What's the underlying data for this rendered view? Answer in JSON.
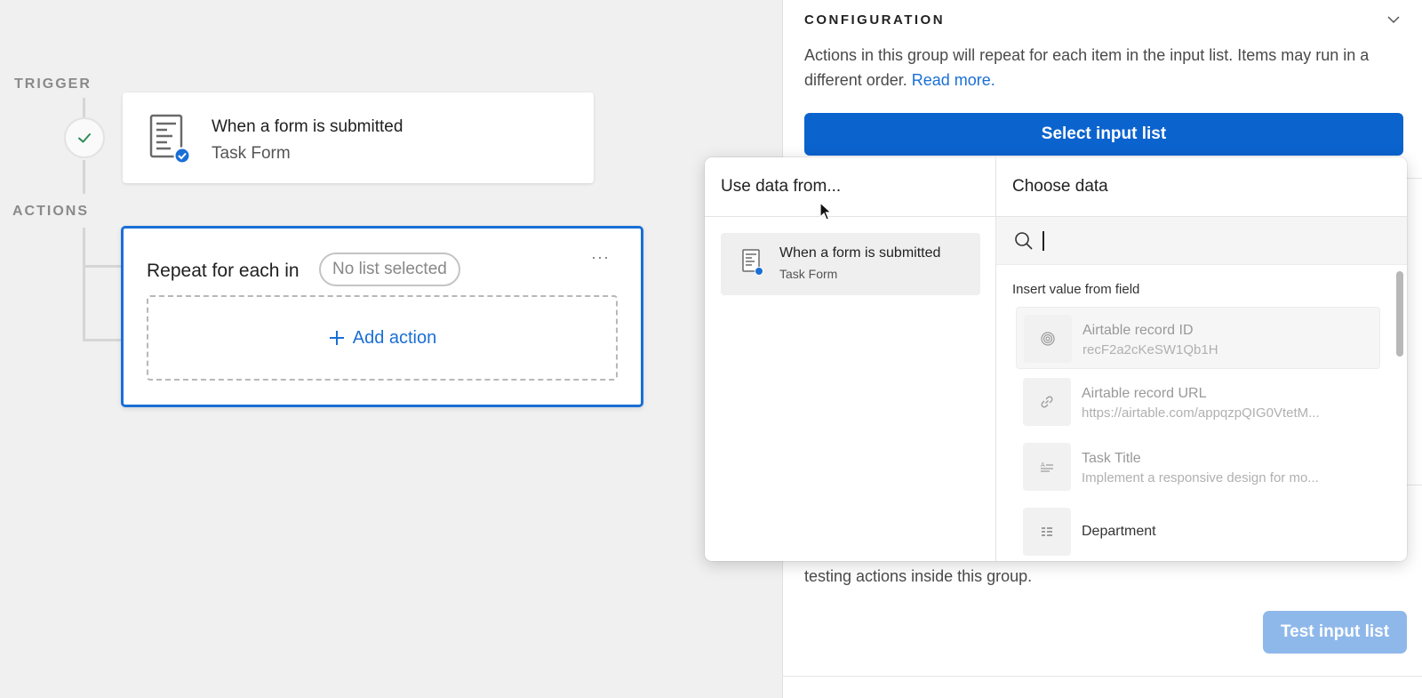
{
  "canvas": {
    "trigger_label": "TRIGGER",
    "actions_label": "ACTIONS",
    "trigger_card": {
      "title": "When a form is submitted",
      "subtitle": "Task Form"
    },
    "repeat_card": {
      "label": "Repeat for each in",
      "pill": "No list selected",
      "menu": "···",
      "add_action": "Add action"
    }
  },
  "panel": {
    "title": "CONFIGURATION",
    "description": "Actions in this group will repeat for each item in the input list. Items may run in a different order.",
    "read_more": "Read more.",
    "select_button": "Select input list",
    "testing_text": "testing actions inside this group.",
    "test_button": "Test input list"
  },
  "popover": {
    "left_header": "Use data from...",
    "right_header": "Choose data",
    "source": {
      "title": "When a form is submitted",
      "subtitle": "Task Form"
    },
    "search_placeholder": "",
    "insert_label": "Insert value from field",
    "fields": [
      {
        "name": "Airtable record ID",
        "value": "recF2a2cKeSW1Qb1H",
        "icon": "fingerprint-icon"
      },
      {
        "name": "Airtable record URL",
        "value": "https://airtable.com/appqzpQIG0VtetM...",
        "icon": "link-icon"
      },
      {
        "name": "Task Title",
        "value": "Implement a responsive design for mo...",
        "icon": "text-field-icon"
      },
      {
        "name": "Department",
        "value": "",
        "icon": "long-text-icon"
      }
    ]
  },
  "colors": {
    "accent": "#0b63ce",
    "accent_light": "#8fb8ea",
    "link": "#1a6fd6"
  }
}
